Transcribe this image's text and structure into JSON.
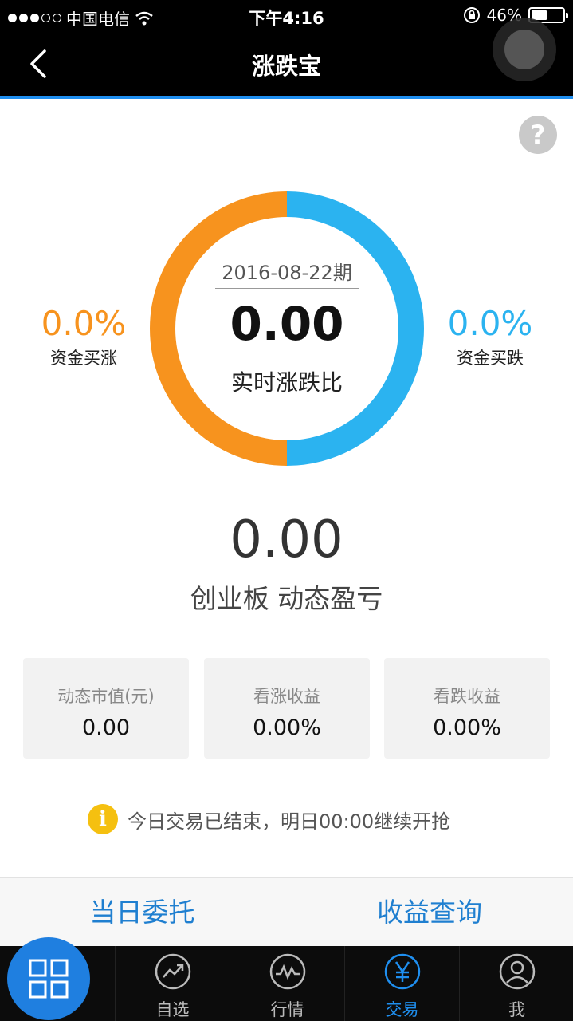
{
  "status_bar": {
    "carrier": "中国电信",
    "time": "下午4:16",
    "battery_pct": "46%"
  },
  "nav": {
    "title": "涨跌宝"
  },
  "ring": {
    "period": "2016-08-22期",
    "ratio_value": "0.00",
    "ratio_label": "实时涨跌比",
    "buy_up_pct": "0.0%",
    "buy_up_label": "资金买涨",
    "buy_down_pct": "0.0%",
    "buy_down_label": "资金买跌"
  },
  "pnl": {
    "value": "0.00",
    "label": "创业板 动态盈亏"
  },
  "stats": [
    {
      "label": "动态市值(元)",
      "value": "0.00"
    },
    {
      "label": "看涨收益",
      "value": "0.00%"
    },
    {
      "label": "看跌收益",
      "value": "0.00%"
    }
  ],
  "notice": {
    "text": "今日交易已结束，明日00:00继续开抢"
  },
  "actions": {
    "entrust": "当日委托",
    "income_query": "收益查询"
  },
  "tabs": [
    {
      "label": "自选",
      "icon": "trend-up-icon"
    },
    {
      "label": "行情",
      "icon": "market-wave-icon"
    },
    {
      "label": "交易",
      "icon": "yen-icon",
      "active": true
    },
    {
      "label": "我",
      "icon": "user-icon"
    }
  ],
  "colors": {
    "up": "#f7931e",
    "down": "#2bb3f0",
    "accent": "#1f8ff0"
  }
}
